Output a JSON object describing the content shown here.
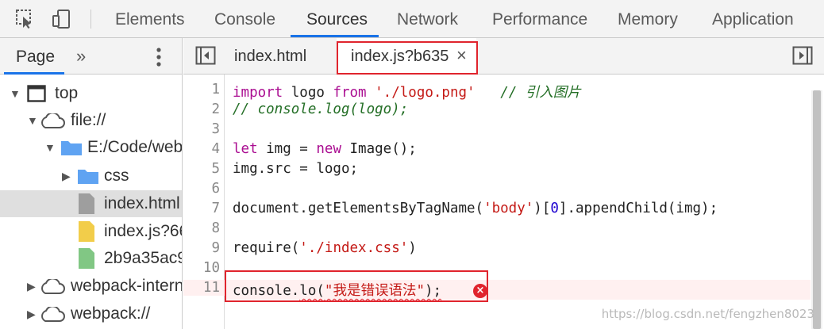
{
  "toolbar": {
    "tabs": [
      "Elements",
      "Console",
      "Sources",
      "Network",
      "Performance",
      "Memory",
      "Application"
    ],
    "active_tab": "Sources",
    "accent": "#1a73e8"
  },
  "sidebar": {
    "title": "Page",
    "more": "»",
    "tree": [
      {
        "label": "top",
        "icon": "frame-icon"
      },
      {
        "label": "file://",
        "icon": "cloud-icon"
      },
      {
        "label": "E:/Code/web",
        "icon": "folder-icon"
      },
      {
        "label": "css",
        "icon": "folder-icon"
      },
      {
        "label": "index.html",
        "icon": "file-icon",
        "selected": true
      },
      {
        "label": "index.js?66",
        "icon": "js-file-icon"
      },
      {
        "label": "2b9a35ac9",
        "icon": "image-file-icon"
      },
      {
        "label": "webpack-intern",
        "icon": "cloud-icon"
      },
      {
        "label": "webpack://",
        "icon": "cloud-icon"
      }
    ]
  },
  "editor": {
    "tabs": [
      {
        "label": "index.html"
      },
      {
        "label": "index.js?b635",
        "active": true,
        "close": "×"
      }
    ],
    "line_numbers": [
      "1",
      "2",
      "3",
      "4",
      "5",
      "6",
      "7",
      "8",
      "9",
      "10",
      "11"
    ],
    "code": {
      "l1_kw1": "import",
      "l1_id": " logo ",
      "l1_kw2": "from",
      "l1_sp": " ",
      "l1_str": "'./logo.png'",
      "l1_sp2": "   ",
      "l1_cmt": "// 引入图片",
      "l2_cmt": "// console.log(logo);",
      "l4_kw1": "let",
      "l4_a": " img = ",
      "l4_kw2": "new",
      "l4_b": " Image();",
      "l5": "img.src = logo;",
      "l7_a": "document.getElementsByTagName(",
      "l7_str": "'body'",
      "l7_b": ")[",
      "l7_num": "0",
      "l7_c": "].appendChild(img);",
      "l9_a": "require(",
      "l9_str": "'./index.css'",
      "l9_b": ")",
      "l11_a": "console.",
      "l11_err": "lo",
      "l11_b": "(",
      "l11_str": "\"我是错误语法\"",
      "l11_c": ");"
    },
    "error_icon": "×"
  },
  "watermark": "https://blog.csdn.net/fengzhen8023",
  "colors": {
    "error": "#e0242d",
    "selected_row": "#dfdfdf",
    "string": "#c41a16",
    "keyword": "#aa0d91",
    "comment": "#236e25"
  }
}
